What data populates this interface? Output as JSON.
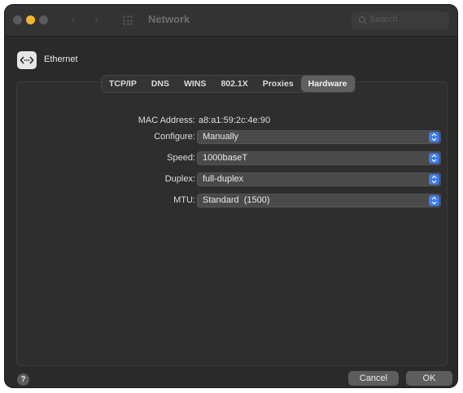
{
  "window": {
    "title": "Network",
    "search_placeholder": "Search",
    "nav": {
      "back": "‹",
      "forward": "›"
    }
  },
  "device": {
    "name": "Ethernet"
  },
  "tabs": [
    {
      "label": "TCP/IP",
      "active": false
    },
    {
      "label": "DNS",
      "active": false
    },
    {
      "label": "WINS",
      "active": false
    },
    {
      "label": "802.1X",
      "active": false
    },
    {
      "label": "Proxies",
      "active": false
    },
    {
      "label": "Hardware",
      "active": true
    }
  ],
  "hardware": {
    "mac_label": "MAC Address:",
    "mac_value": "a8:a1:59:2c:4e:90",
    "configure_label": "Configure:",
    "configure_value": "Manually",
    "speed_label": "Speed:",
    "speed_value": "1000baseT",
    "duplex_label": "Duplex:",
    "duplex_value": "full-duplex",
    "mtu_label": "MTU:",
    "mtu_value": "Standard  (1500)"
  },
  "footer": {
    "help": "?",
    "cancel": "Cancel",
    "ok": "OK"
  },
  "colors": {
    "window_bg": "#2a2a2a",
    "accent": "#3d7bf5",
    "minimize_light": "#f5b72a"
  }
}
